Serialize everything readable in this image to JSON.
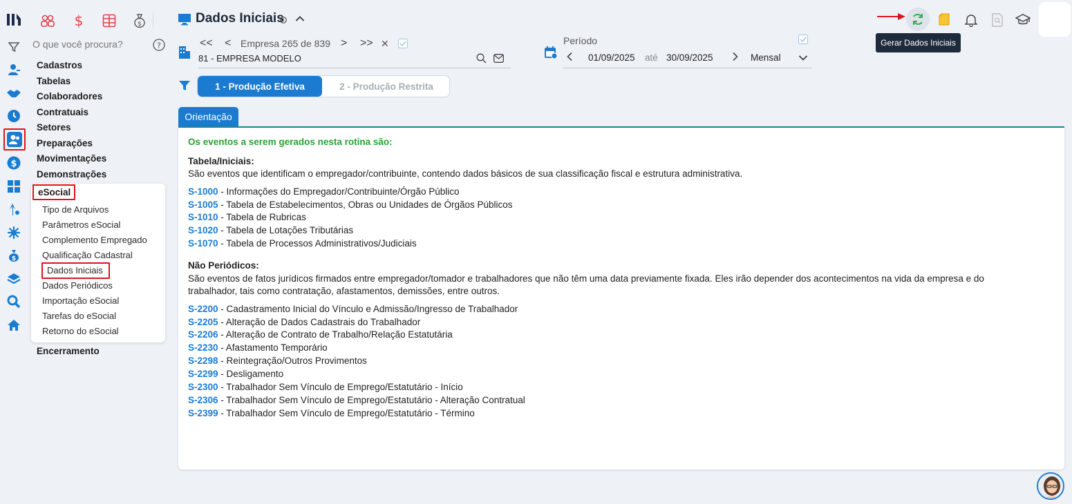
{
  "menu": {
    "search_placeholder": "O que você procura?",
    "items": [
      "Cadastros",
      "Tabelas",
      "Colaboradores",
      "Contratuais",
      "Setores",
      "Preparações",
      "Movimentações",
      "Demonstrações"
    ],
    "esocial": "eSocial",
    "subitems": [
      "Tipo de Arquivos",
      "Parâmetros eSocial",
      "Complemento Empregado",
      "Qualificação Cadastral",
      "Dados Iniciais",
      "Dados Periódicos",
      "Importação eSocial",
      "Tarefas do eSocial",
      "Retorno do eSocial"
    ],
    "last": "Encerramento"
  },
  "header": {
    "title": "Dados Iniciais",
    "empresa_nav": "Empresa 265 de 839",
    "empresa_nav_prev2": "<<",
    "empresa_nav_prev": "<",
    "empresa_nav_next": ">",
    "empresa_nav_next2": ">>",
    "empresa_close": "✕",
    "empresa_name": "81 - EMPRESA MODELO",
    "periodo_label": "Período",
    "periodo_start": "01/09/2025",
    "periodo_ate": "até",
    "periodo_end": "30/09/2025",
    "periodo_type": "Mensal",
    "tooltip": "Gerar Dados Iniciais"
  },
  "tabs": {
    "tab1": "1 - Produção Efetiva",
    "tab2": "2 - Produção Restrita"
  },
  "content": {
    "tab": "Orientação",
    "intro": "Os eventos a serem gerados nesta rotina são:",
    "section1_title": "Tabela/Iniciais:",
    "section1_desc": "São eventos que identificam o empregador/contribuinte, contendo dados básicos de sua classificação fiscal e estrutura administrativa.",
    "section1_events": [
      {
        "code": "S-1000",
        "desc": " - Informações do Empregador/Contribuinte/Órgão Público"
      },
      {
        "code": "S-1005",
        "desc": " - Tabela de Estabelecimentos, Obras ou Unidades de Órgãos Públicos"
      },
      {
        "code": "S-1010",
        "desc": " - Tabela de Rubricas"
      },
      {
        "code": "S-1020",
        "desc": " - Tabela de Lotações Tributárias"
      },
      {
        "code": "S-1070",
        "desc": " - Tabela de Processos Administrativos/Judiciais"
      }
    ],
    "section2_title": "Não Periódicos:",
    "section2_desc1": "São eventos de fatos jurídicos firmados entre empregador/tomador e trabalhadores que não têm uma data previamente fixada. Eles irão depender dos acontecimentos na vida da empresa e do",
    "section2_desc2": "trabalhador, tais como contratação, afastamentos, demissões, entre outros.",
    "section2_events": [
      {
        "code": "S-2200",
        "desc": " - Cadastramento Inicial do Vínculo e Admissão/Ingresso de Trabalhador"
      },
      {
        "code": "S-2205",
        "desc": " - Alteração de Dados Cadastrais do Trabalhador"
      },
      {
        "code": "S-2206",
        "desc": " - Alteração de Contrato de Trabalho/Relação Estatutária"
      },
      {
        "code": "S-2230",
        "desc": " - Afastamento Temporário"
      },
      {
        "code": "S-2298",
        "desc": " - Reintegração/Outros Provimentos"
      },
      {
        "code": "S-2299",
        "desc": " - Desligamento"
      },
      {
        "code": "S-2300",
        "desc": " - Trabalhador Sem Vínculo de Emprego/Estatutário - Início"
      },
      {
        "code": "S-2306",
        "desc": " - Trabalhador Sem Vínculo de Emprego/Estatutário - Alteração Contratual"
      },
      {
        "code": "S-2399",
        "desc": " - Trabalhador Sem Vínculo de Emprego/Estatutário - Término"
      }
    ]
  },
  "colors": {
    "accent": "#1b7bd1",
    "highlight": "#e0121b",
    "green": "#26a232"
  }
}
